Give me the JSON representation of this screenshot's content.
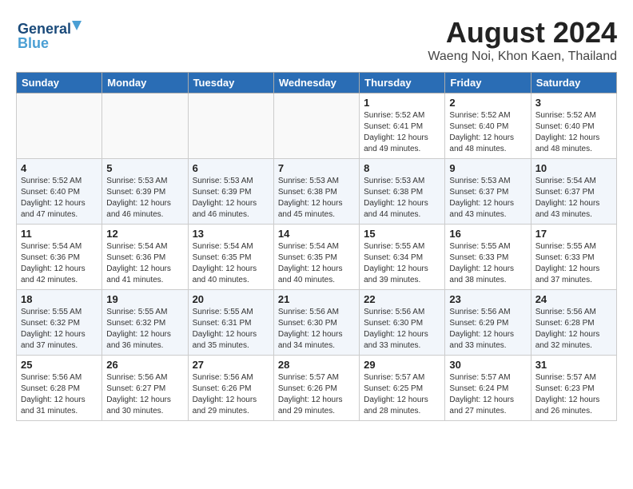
{
  "header": {
    "logo_line1": "General",
    "logo_line2": "Blue",
    "title": "August 2024",
    "subtitle": "Waeng Noi, Khon Kaen, Thailand"
  },
  "weekdays": [
    "Sunday",
    "Monday",
    "Tuesday",
    "Wednesday",
    "Thursday",
    "Friday",
    "Saturday"
  ],
  "weeks": [
    [
      {
        "day": "",
        "info": ""
      },
      {
        "day": "",
        "info": ""
      },
      {
        "day": "",
        "info": ""
      },
      {
        "day": "",
        "info": ""
      },
      {
        "day": "1",
        "info": "Sunrise: 5:52 AM\nSunset: 6:41 PM\nDaylight: 12 hours\nand 49 minutes."
      },
      {
        "day": "2",
        "info": "Sunrise: 5:52 AM\nSunset: 6:40 PM\nDaylight: 12 hours\nand 48 minutes."
      },
      {
        "day": "3",
        "info": "Sunrise: 5:52 AM\nSunset: 6:40 PM\nDaylight: 12 hours\nand 48 minutes."
      }
    ],
    [
      {
        "day": "4",
        "info": "Sunrise: 5:52 AM\nSunset: 6:40 PM\nDaylight: 12 hours\nand 47 minutes."
      },
      {
        "day": "5",
        "info": "Sunrise: 5:53 AM\nSunset: 6:39 PM\nDaylight: 12 hours\nand 46 minutes."
      },
      {
        "day": "6",
        "info": "Sunrise: 5:53 AM\nSunset: 6:39 PM\nDaylight: 12 hours\nand 46 minutes."
      },
      {
        "day": "7",
        "info": "Sunrise: 5:53 AM\nSunset: 6:38 PM\nDaylight: 12 hours\nand 45 minutes."
      },
      {
        "day": "8",
        "info": "Sunrise: 5:53 AM\nSunset: 6:38 PM\nDaylight: 12 hours\nand 44 minutes."
      },
      {
        "day": "9",
        "info": "Sunrise: 5:53 AM\nSunset: 6:37 PM\nDaylight: 12 hours\nand 43 minutes."
      },
      {
        "day": "10",
        "info": "Sunrise: 5:54 AM\nSunset: 6:37 PM\nDaylight: 12 hours\nand 43 minutes."
      }
    ],
    [
      {
        "day": "11",
        "info": "Sunrise: 5:54 AM\nSunset: 6:36 PM\nDaylight: 12 hours\nand 42 minutes."
      },
      {
        "day": "12",
        "info": "Sunrise: 5:54 AM\nSunset: 6:36 PM\nDaylight: 12 hours\nand 41 minutes."
      },
      {
        "day": "13",
        "info": "Sunrise: 5:54 AM\nSunset: 6:35 PM\nDaylight: 12 hours\nand 40 minutes."
      },
      {
        "day": "14",
        "info": "Sunrise: 5:54 AM\nSunset: 6:35 PM\nDaylight: 12 hours\nand 40 minutes."
      },
      {
        "day": "15",
        "info": "Sunrise: 5:55 AM\nSunset: 6:34 PM\nDaylight: 12 hours\nand 39 minutes."
      },
      {
        "day": "16",
        "info": "Sunrise: 5:55 AM\nSunset: 6:33 PM\nDaylight: 12 hours\nand 38 minutes."
      },
      {
        "day": "17",
        "info": "Sunrise: 5:55 AM\nSunset: 6:33 PM\nDaylight: 12 hours\nand 37 minutes."
      }
    ],
    [
      {
        "day": "18",
        "info": "Sunrise: 5:55 AM\nSunset: 6:32 PM\nDaylight: 12 hours\nand 37 minutes."
      },
      {
        "day": "19",
        "info": "Sunrise: 5:55 AM\nSunset: 6:32 PM\nDaylight: 12 hours\nand 36 minutes."
      },
      {
        "day": "20",
        "info": "Sunrise: 5:55 AM\nSunset: 6:31 PM\nDaylight: 12 hours\nand 35 minutes."
      },
      {
        "day": "21",
        "info": "Sunrise: 5:56 AM\nSunset: 6:30 PM\nDaylight: 12 hours\nand 34 minutes."
      },
      {
        "day": "22",
        "info": "Sunrise: 5:56 AM\nSunset: 6:30 PM\nDaylight: 12 hours\nand 33 minutes."
      },
      {
        "day": "23",
        "info": "Sunrise: 5:56 AM\nSunset: 6:29 PM\nDaylight: 12 hours\nand 33 minutes."
      },
      {
        "day": "24",
        "info": "Sunrise: 5:56 AM\nSunset: 6:28 PM\nDaylight: 12 hours\nand 32 minutes."
      }
    ],
    [
      {
        "day": "25",
        "info": "Sunrise: 5:56 AM\nSunset: 6:28 PM\nDaylight: 12 hours\nand 31 minutes."
      },
      {
        "day": "26",
        "info": "Sunrise: 5:56 AM\nSunset: 6:27 PM\nDaylight: 12 hours\nand 30 minutes."
      },
      {
        "day": "27",
        "info": "Sunrise: 5:56 AM\nSunset: 6:26 PM\nDaylight: 12 hours\nand 29 minutes."
      },
      {
        "day": "28",
        "info": "Sunrise: 5:57 AM\nSunset: 6:26 PM\nDaylight: 12 hours\nand 29 minutes."
      },
      {
        "day": "29",
        "info": "Sunrise: 5:57 AM\nSunset: 6:25 PM\nDaylight: 12 hours\nand 28 minutes."
      },
      {
        "day": "30",
        "info": "Sunrise: 5:57 AM\nSunset: 6:24 PM\nDaylight: 12 hours\nand 27 minutes."
      },
      {
        "day": "31",
        "info": "Sunrise: 5:57 AM\nSunset: 6:23 PM\nDaylight: 12 hours\nand 26 minutes."
      }
    ]
  ]
}
